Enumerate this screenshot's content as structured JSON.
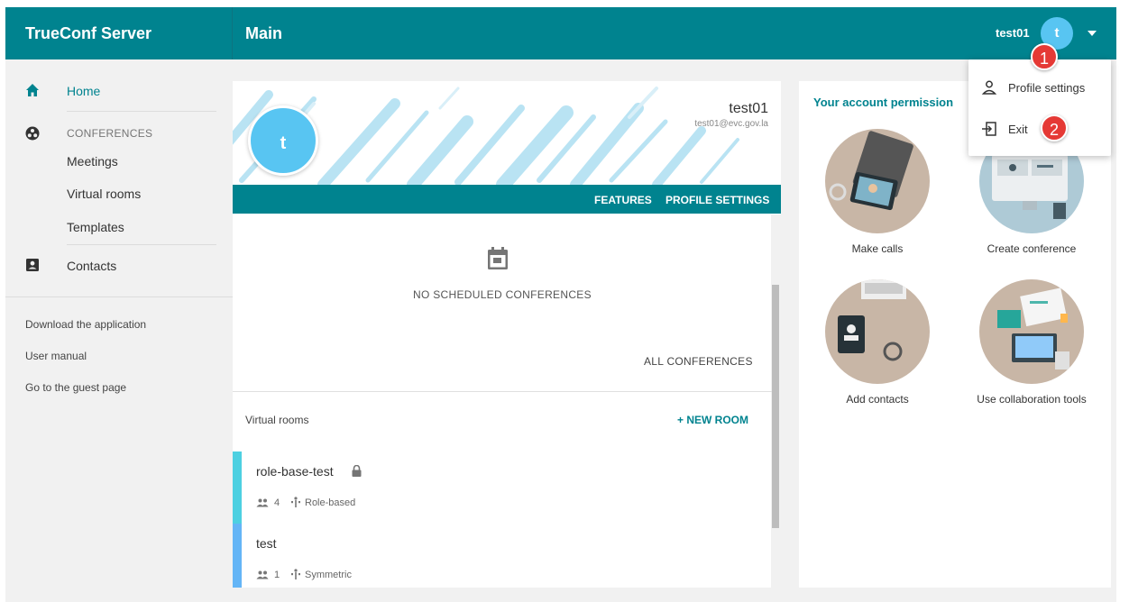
{
  "app": {
    "brand": "TrueConf Server",
    "page_title": "Main"
  },
  "user": {
    "name": "test01",
    "initial": "t",
    "email": "test01@evc.gov.la"
  },
  "colors": {
    "teal": "#00838f",
    "avatar": "#58c5f2",
    "badge": "#e53935"
  },
  "sidebar": {
    "home": "Home",
    "conferences_header": "CONFERENCES",
    "meetings": "Meetings",
    "virtual_rooms": "Virtual rooms",
    "templates": "Templates",
    "contacts": "Contacts",
    "download": "Download the application",
    "manual": "User manual",
    "guest": "Go to the guest page"
  },
  "profile": {
    "features": "FEATURES",
    "profile_settings": "PROFILE SETTINGS",
    "no_conf": "NO SCHEDULED CONFERENCES",
    "all_conf": "ALL CONFERENCES",
    "virtual_rooms_label": "Virtual rooms",
    "new_room": "+ NEW ROOM"
  },
  "rooms": [
    {
      "name": "role-base-test",
      "count": "4",
      "type": "Role-based",
      "strip": "#4dd0e1",
      "locked": true
    },
    {
      "name": "test",
      "count": "1",
      "type": "Symmetric",
      "strip": "#64b5f6",
      "locked": false
    }
  ],
  "permissions": {
    "title": "Your account permission",
    "tiles": [
      "Make calls",
      "Create conference",
      "Add contacts",
      "Use collaboration tools"
    ]
  },
  "menu": {
    "profile_settings": "Profile settings",
    "exit": "Exit"
  },
  "badges": [
    "1",
    "2"
  ]
}
